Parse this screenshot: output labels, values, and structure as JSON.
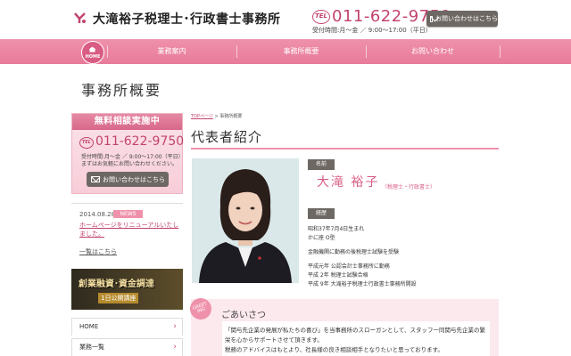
{
  "header": {
    "site_title": "大滝裕子税理士･行政書士事務所",
    "tel_icon_text": "TEL",
    "tel_number": "011-622-9750",
    "tel_hours": "受付時間:月～金 ／ 9:00～17:00（平日）",
    "contact_button": "お問い合わせはこちら"
  },
  "nav": {
    "home_label": "HOME",
    "items": [
      {
        "label": "業務案内"
      },
      {
        "label": "事務所概要"
      },
      {
        "label": "お問い合わせ"
      }
    ]
  },
  "page": {
    "title": "事務所概要"
  },
  "sidebar": {
    "consult_title": "無料相談実施中",
    "consult_tel_icon": "TEL",
    "consult_tel": "011-622-9750",
    "consult_hours": "受付時間:月～金 ／ 9:00～17:00（平日）",
    "consult_note": "まずはお気軽にお問い合わせください。",
    "consult_button": "お問い合わせはこちら",
    "news": {
      "date": "2014.08.28",
      "badge": "NEWS",
      "text": "ホームページをリニューアルいたしました。",
      "all_link": "一覧はこちら"
    },
    "promo": {
      "main": "創業融資･資金調達",
      "sub": "1日公開講座"
    },
    "menu": [
      {
        "label": "HOME"
      },
      {
        "label": "業務一覧"
      }
    ]
  },
  "main": {
    "breadcrumb_top": "TOPページ",
    "breadcrumb_sep": " > ",
    "breadcrumb_current": "事務所概要",
    "section_title": "代表者紹介",
    "name_label": "名前",
    "name": "大滝 裕子",
    "name_title": "（税理士・行政書士）",
    "career_label": "経歴",
    "career_lines": [
      "昭和37年7月4日生まれ",
      "かに座 O型",
      "金融機関に勤務の後税理士試験を受験",
      "平成元年 公認会計士事務所に勤務",
      "平成 2年 税理士試験合格",
      "平成 9年 大滝裕子税理士行政書士事務所開設"
    ],
    "greeting_badge": "GREET ING",
    "greeting_title": "ごあいさつ",
    "greeting_lines": [
      "「関与先企業の発展が私たちの喜び」を当事務所のスローガンとして、スタッフ一同関与先企業の繁",
      "栄を心からサポートさせて頂きます。",
      "税務のアドバイスはもとより、社長様の良き相談相手となりたいと思っております。"
    ]
  },
  "colors": {
    "accent_pink": "#ef91ab",
    "deep_pink": "#c2446e",
    "button_gray": "#6e6864"
  }
}
